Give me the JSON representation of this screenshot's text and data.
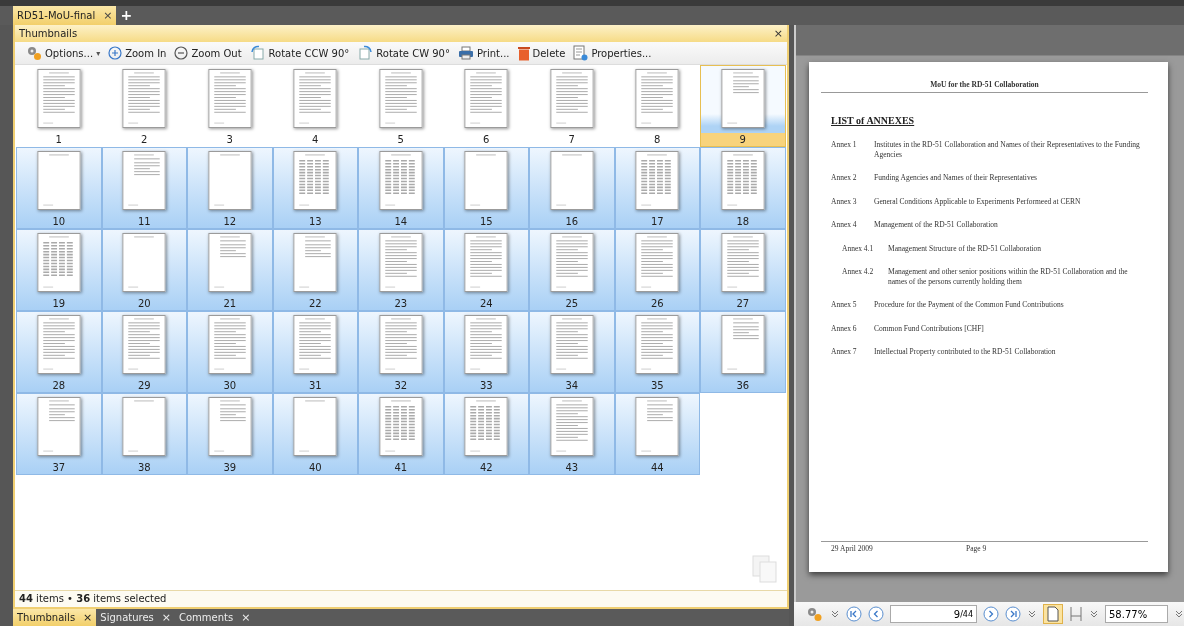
{
  "document_tab": {
    "title": "RD51-MoU-final",
    "close": "×",
    "new_tab": "+"
  },
  "panel": {
    "title": "Thumbnails",
    "close": "×"
  },
  "toolbar": [
    {
      "kind": "options",
      "label": "Options...",
      "caret": "▾"
    },
    {
      "kind": "zoom-in",
      "label": "Zoom In"
    },
    {
      "kind": "zoom-out",
      "label": "Zoom Out"
    },
    {
      "kind": "rotate-ccw",
      "label": "Rotate CCW 90°"
    },
    {
      "kind": "rotate-cw",
      "label": "Rotate CW 90°"
    },
    {
      "kind": "print",
      "label": "Print..."
    },
    {
      "kind": "delete",
      "label": "Delete"
    },
    {
      "kind": "properties",
      "label": "Properties..."
    }
  ],
  "thumbnails": [
    {
      "label": "1",
      "kind": "text",
      "selected": false,
      "current": false
    },
    {
      "label": "2",
      "kind": "text",
      "selected": false,
      "current": false
    },
    {
      "label": "3",
      "kind": "text",
      "selected": false,
      "current": false
    },
    {
      "label": "4",
      "kind": "text",
      "selected": false,
      "current": false
    },
    {
      "label": "5",
      "kind": "text",
      "selected": false,
      "current": false
    },
    {
      "label": "6",
      "kind": "text",
      "selected": false,
      "current": false
    },
    {
      "label": "7",
      "kind": "text",
      "selected": false,
      "current": false
    },
    {
      "label": "8",
      "kind": "text",
      "selected": false,
      "current": false
    },
    {
      "label": "9",
      "kind": "list",
      "selected": true,
      "current": true
    },
    {
      "label": "10",
      "kind": "blank",
      "selected": true,
      "current": false
    },
    {
      "label": "11",
      "kind": "list",
      "selected": true,
      "current": false
    },
    {
      "label": "12",
      "kind": "blank",
      "selected": true,
      "current": false
    },
    {
      "label": "13",
      "kind": "table",
      "selected": true,
      "current": false
    },
    {
      "label": "14",
      "kind": "table",
      "selected": true,
      "current": false
    },
    {
      "label": "15",
      "kind": "blank",
      "selected": true,
      "current": false
    },
    {
      "label": "16",
      "kind": "blank",
      "selected": true,
      "current": false
    },
    {
      "label": "17",
      "kind": "table",
      "selected": true,
      "current": false
    },
    {
      "label": "18",
      "kind": "table",
      "selected": true,
      "current": false
    },
    {
      "label": "19",
      "kind": "table",
      "selected": true,
      "current": false
    },
    {
      "label": "20",
      "kind": "blank",
      "selected": true,
      "current": false
    },
    {
      "label": "21",
      "kind": "list",
      "selected": true,
      "current": false
    },
    {
      "label": "22",
      "kind": "list",
      "selected": true,
      "current": false
    },
    {
      "label": "23",
      "kind": "text",
      "selected": true,
      "current": false
    },
    {
      "label": "24",
      "kind": "text",
      "selected": true,
      "current": false
    },
    {
      "label": "25",
      "kind": "text",
      "selected": true,
      "current": false
    },
    {
      "label": "26",
      "kind": "text",
      "selected": true,
      "current": false
    },
    {
      "label": "27",
      "kind": "text",
      "selected": true,
      "current": false
    },
    {
      "label": "28",
      "kind": "text",
      "selected": true,
      "current": false
    },
    {
      "label": "29",
      "kind": "text",
      "selected": true,
      "current": false
    },
    {
      "label": "30",
      "kind": "text",
      "selected": true,
      "current": false
    },
    {
      "label": "31",
      "kind": "text",
      "selected": true,
      "current": false
    },
    {
      "label": "32",
      "kind": "text",
      "selected": true,
      "current": false
    },
    {
      "label": "33",
      "kind": "text",
      "selected": true,
      "current": false
    },
    {
      "label": "34",
      "kind": "text",
      "selected": true,
      "current": false
    },
    {
      "label": "35",
      "kind": "text",
      "selected": true,
      "current": false
    },
    {
      "label": "36",
      "kind": "list",
      "selected": true,
      "current": false
    },
    {
      "label": "37",
      "kind": "list",
      "selected": true,
      "current": false
    },
    {
      "label": "38",
      "kind": "blank",
      "selected": true,
      "current": false
    },
    {
      "label": "39",
      "kind": "list",
      "selected": true,
      "current": false
    },
    {
      "label": "40",
      "kind": "blank",
      "selected": true,
      "current": false
    },
    {
      "label": "41",
      "kind": "table",
      "selected": true,
      "current": false
    },
    {
      "label": "42",
      "kind": "table",
      "selected": true,
      "current": false
    },
    {
      "label": "43",
      "kind": "text",
      "selected": true,
      "current": false
    },
    {
      "label": "44",
      "kind": "list",
      "selected": true,
      "current": false
    }
  ],
  "status_bar": "**44** items • **36** items selected",
  "bottom_tabs": [
    {
      "label": "Thumbnails",
      "close": "×",
      "selected": true
    },
    {
      "label": "Signatures",
      "close": "×",
      "selected": false
    },
    {
      "label": "Comments",
      "close": "×",
      "selected": false
    }
  ],
  "page": {
    "header": "MoU for the RD-51 Collaboration",
    "heading": "LIST of ANNEXES",
    "annexes": [
      {
        "label": "Annex 1",
        "title": "Institutes in the RD-51 Collaboration and Names of their Representatives to the Funding Agencies"
      },
      {
        "label": "Annex 2",
        "title": "Funding Agencies and Names of their Representatives"
      },
      {
        "label": "Annex 3",
        "title": "General Conditions Applicable to Experiments Performeed at CERN"
      },
      {
        "label": "Annex 4",
        "title": "Management of the RD-51 Collaboration",
        "children": [
          {
            "label": "Annex 4.1",
            "title": "Management Structure of the RD-51 Collaboration"
          },
          {
            "label": "Annex 4.2",
            "title": "Management and other senior positions within the RD-51 Collaboration and the names of the persons currently holding them"
          }
        ]
      },
      {
        "label": "Annex 5",
        "title": "Procedure for the Payment of the Common Fund Contributions"
      },
      {
        "label": "Annex 6",
        "title": "Common Fund Contributions [CHF]"
      },
      {
        "label": "Annex 7",
        "title": "Intellectual Property contributed to the RD-51 Collaboration"
      }
    ],
    "footer_date": "29 April 2009",
    "footer_page": "Page 9"
  },
  "navigation": {
    "page_value": "9",
    "page_total": "/44",
    "zoom": "58.77%",
    "single_page_selected": true
  }
}
